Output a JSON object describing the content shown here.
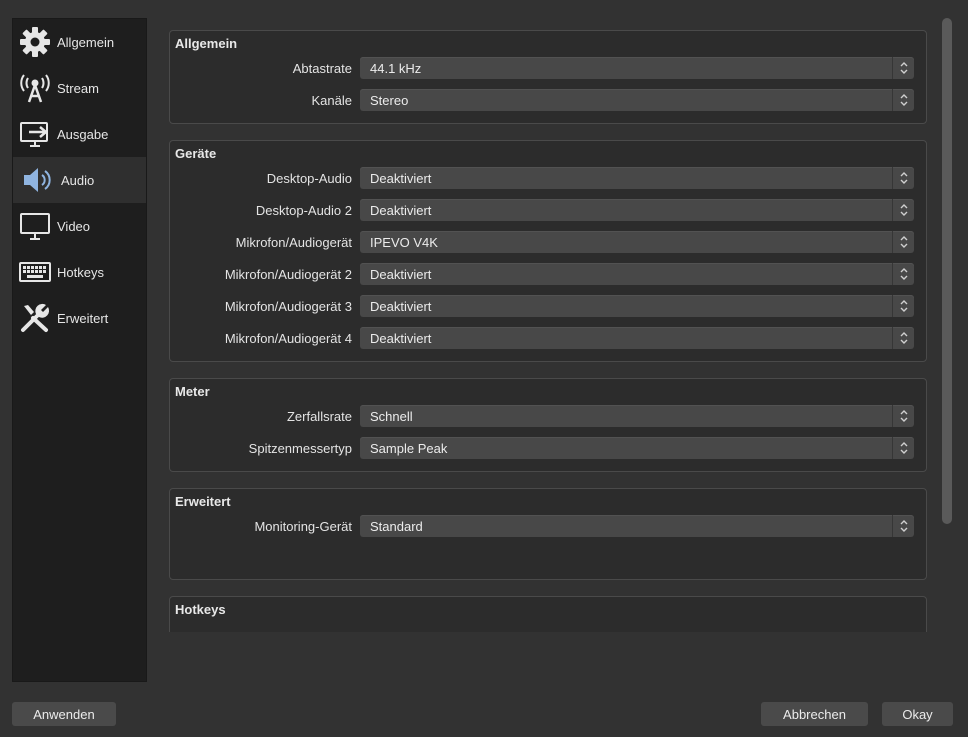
{
  "sidebar": {
    "items": [
      {
        "label": "Allgemein",
        "icon": "gear-icon"
      },
      {
        "label": "Stream",
        "icon": "antenna-icon"
      },
      {
        "label": "Ausgabe",
        "icon": "output-icon"
      },
      {
        "label": "Audio",
        "icon": "speaker-icon",
        "active": true
      },
      {
        "label": "Video",
        "icon": "monitor-icon"
      },
      {
        "label": "Hotkeys",
        "icon": "keyboard-icon"
      },
      {
        "label": "Erweitert",
        "icon": "tools-icon"
      }
    ]
  },
  "groups": {
    "allgemein": {
      "title": "Allgemein",
      "rows": [
        {
          "label": "Abtastrate",
          "value": "44.1 kHz"
        },
        {
          "label": "Kanäle",
          "value": "Stereo"
        }
      ]
    },
    "geraete": {
      "title": "Geräte",
      "rows": [
        {
          "label": "Desktop-Audio",
          "value": "Deaktiviert"
        },
        {
          "label": "Desktop-Audio 2",
          "value": "Deaktiviert"
        },
        {
          "label": "Mikrofon/Audiogerät",
          "value": "IPEVO V4K"
        },
        {
          "label": "Mikrofon/Audiogerät 2",
          "value": "Deaktiviert"
        },
        {
          "label": "Mikrofon/Audiogerät 3",
          "value": "Deaktiviert"
        },
        {
          "label": "Mikrofon/Audiogerät 4",
          "value": "Deaktiviert"
        }
      ]
    },
    "meter": {
      "title": "Meter",
      "rows": [
        {
          "label": "Zerfallsrate",
          "value": "Schnell"
        },
        {
          "label": "Spitzenmessertyp",
          "value": "Sample Peak"
        }
      ]
    },
    "erweitert": {
      "title": "Erweitert",
      "rows": [
        {
          "label": "Monitoring-Gerät",
          "value": "Standard"
        }
      ]
    },
    "hotkeys": {
      "title": "Hotkeys"
    }
  },
  "buttons": {
    "apply": "Anwenden",
    "cancel": "Abbrechen",
    "ok": "Okay"
  },
  "colors": {
    "window_bg": "#323232",
    "sidebar_bg": "#1e1e1e",
    "sidebar_active": "#2f2f2f",
    "select_bg": "#484848",
    "accent_icon": "#8fb4e0"
  }
}
